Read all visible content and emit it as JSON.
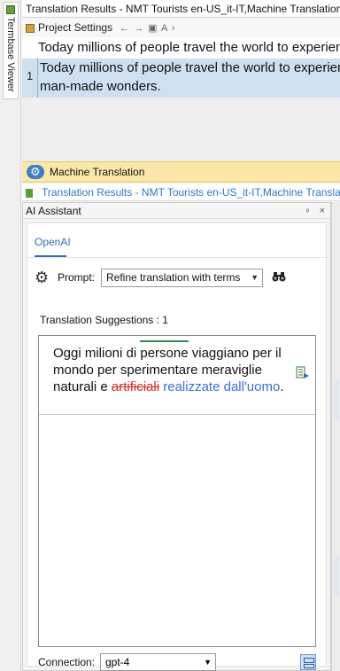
{
  "left_strip": {
    "termbase_tab_label": "Termbase Viewer"
  },
  "translation_results": {
    "title": "Translation Results - NMT Tourists en-US_it-IT,Machine Translation",
    "toolbar": {
      "project_settings_label": "Project Settings",
      "toolbar_glyphs": "← → ▣ A ›"
    },
    "source_text": "Today millions of people travel the world to experience",
    "rows": [
      {
        "number": "1",
        "text": "Today millions of people travel the world to experience\nman-made wonders."
      }
    ]
  },
  "machine_translation": {
    "banner_label": "Machine Translation",
    "sub_tab_label": "Translation Results - NMT Tourists en-US_it-IT,Machine Transla"
  },
  "ai_assistant": {
    "title": "AI Assistant",
    "pin_glyph": "ᵖ",
    "close_glyph": "×",
    "tabs": [
      {
        "label": "OpenAI",
        "active": true
      }
    ],
    "prompt": {
      "label": "Prompt:",
      "selected": "Refine translation with terms",
      "icon": "gear-icon"
    },
    "suggestions_label": "Translation Suggestions :  1",
    "suggestion": {
      "seg1": "Oggi milioni di ",
      "seg2_marked": "persone",
      "seg3": " viaggiano per il mondo per sperimentare meraviglie naturali e ",
      "deleted": "artificiali",
      "seg4": " ",
      "inserted": "realizzate dall'uomo",
      "seg5": "."
    },
    "connection": {
      "label": "Connection:",
      "selected": "gpt-4"
    }
  },
  "colors": {
    "banner_bg": "#fbe8a8",
    "selected_row_bg": "#cfe0f1",
    "accent_blue": "#2f6fb3",
    "deleted_red": "#d12b2b",
    "inserted_blue": "#3c6fd6"
  }
}
